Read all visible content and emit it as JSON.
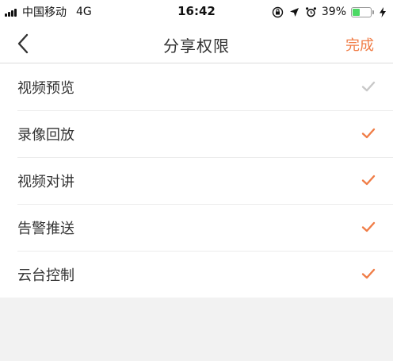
{
  "status_bar": {
    "carrier": "中国移动",
    "network": "4G",
    "time": "16:42",
    "battery_pct": "39%",
    "battery_level": 0.39
  },
  "nav": {
    "title": "分享权限",
    "done_label": "完成",
    "back_icon": "chevron-left-icon"
  },
  "colors": {
    "accent": "#f07d47",
    "check_inactive": "#c8c8c8",
    "text": "#333333",
    "battery_green": "#4cd964"
  },
  "permissions": [
    {
      "label": "视频预览",
      "checked": true,
      "locked": true
    },
    {
      "label": "录像回放",
      "checked": true,
      "locked": false
    },
    {
      "label": "视频对讲",
      "checked": true,
      "locked": false
    },
    {
      "label": "告警推送",
      "checked": true,
      "locked": false
    },
    {
      "label": "云台控制",
      "checked": true,
      "locked": false
    }
  ]
}
